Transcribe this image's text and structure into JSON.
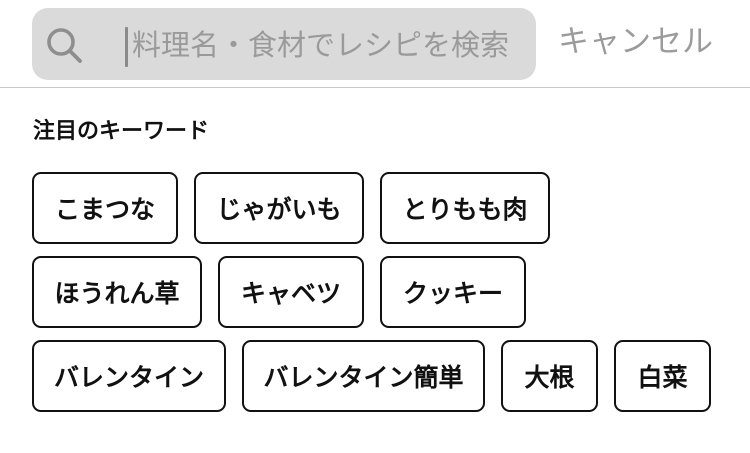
{
  "search": {
    "placeholder": "料理名・食材でレシピを検索",
    "value": "",
    "icon": "search-icon"
  },
  "cancel_label": "キャンセル",
  "section_title": "注目のキーワード",
  "keywords": [
    "こまつな",
    "じゃがいも",
    "とりもも肉",
    "ほうれん草",
    "キャベツ",
    "クッキー",
    "バレンタイン",
    "バレンタイン簡単",
    "大根",
    "白菜"
  ],
  "colors": {
    "search_field_background": "#dadada",
    "placeholder_text": "#9a9a9a",
    "cancel_text": "#9b9b9b",
    "chip_border": "#111111",
    "divider": "#c8c8c8"
  }
}
